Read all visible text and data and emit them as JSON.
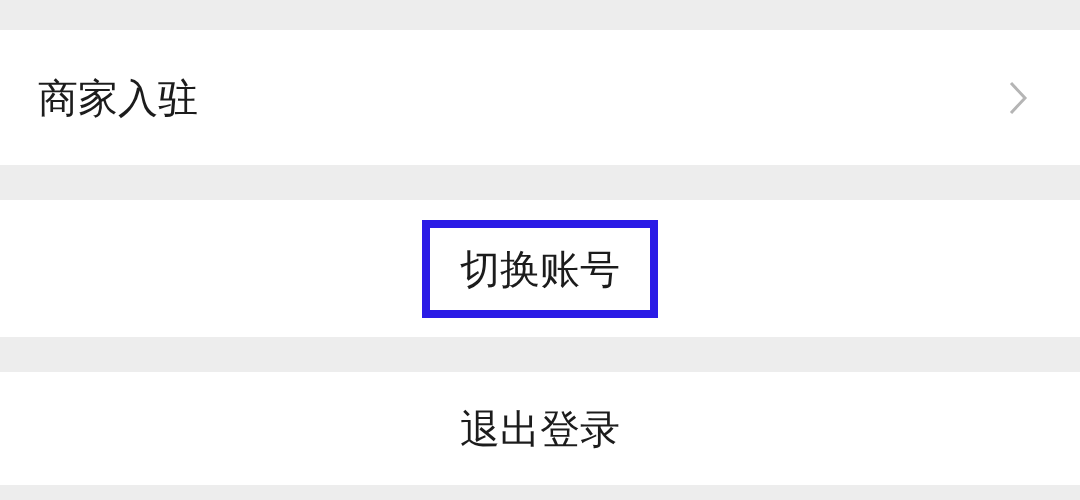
{
  "menu_items": [
    {
      "kind": "link",
      "label": "商家入驻",
      "highlighted": false
    },
    {
      "kind": "action",
      "label": "切换账号",
      "highlighted": true
    },
    {
      "kind": "action",
      "label": "退出登录",
      "highlighted": false
    }
  ]
}
